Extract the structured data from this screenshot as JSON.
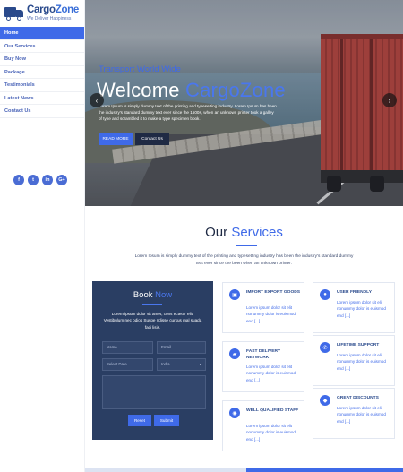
{
  "brand": {
    "name_a": "Cargo",
    "name_b": "Zone",
    "tagline": "We Deliver Happiness"
  },
  "nav": [
    "Home",
    "Our Services",
    "Buy Now",
    "Package",
    "Testimonials",
    "Latest News",
    "Contact Us"
  ],
  "socials": [
    {
      "icon": "facebook-icon",
      "glyph": "f"
    },
    {
      "icon": "twitter-icon",
      "glyph": "t"
    },
    {
      "icon": "linkedin-icon",
      "glyph": "in"
    },
    {
      "icon": "google-plus-icon",
      "glyph": "G+"
    }
  ],
  "hero": {
    "subtitle": "Transport World Wide",
    "title_a": "Welcome",
    "title_b": "CargoZone",
    "description": "Lorem Ipsum is simply dummy text of the printing and typesetting industry. Lorem Ipsum has been the industry's standard dummy text ever since the 1500s, when an unknown printer took a galley of type and scrambled it to make a type specimen book.",
    "read_more": "READ MORE",
    "contact": "Contact Us",
    "prev": "‹",
    "next": "›"
  },
  "services": {
    "heading_a": "Our",
    "heading_b": "Services",
    "intro": "Lorem Ipsum is simply dummy text of the printing and typesetting industry has been the industry's standard dummy text ever since the been when an unknown printer."
  },
  "booking": {
    "title_a": "Book",
    "title_b": "Now",
    "description": "Lorem ipsum dolor sit amet, cons ectetur elit. Vestibulum nec odios Suspe ndisse cursus mal suada faci lisis.",
    "name_placeholder": "Name",
    "email_placeholder": "Email",
    "date_placeholder": "Select Date",
    "select_value": "India",
    "reset": "Reset",
    "submit": "Submit"
  },
  "cards": [
    {
      "icon": "box-icon",
      "glyph": "▣",
      "title": "IMPORT EXPORT GOODS",
      "text": "Lorem ipsum dolor sit elit nonummy dolor is euismod end [...]"
    },
    {
      "icon": "user-icon",
      "glyph": "●",
      "title": "USER FRIENDLY",
      "text": "Lorem ipsum dolor sit elit nonummy dolor is euismod end [...]"
    },
    {
      "icon": "truck-icon",
      "glyph": "▰",
      "title": "FAST DELIVERY NETWORK",
      "text": "Lorem ipsum dolor sit elit nonummy dolor is euismod end [...]"
    },
    {
      "icon": "support-icon",
      "glyph": "✆",
      "title": "LIFETIME SUPPORT",
      "text": "Lorem ipsum dolor sit elit nonummy dolor is euismod end [...]"
    },
    {
      "icon": "location-icon",
      "glyph": "◉",
      "title": "WELL QUALIFIED STAFF",
      "text": "Lorem ipsum dolor sit elit nonummy dolor is euismod end [...]"
    },
    {
      "icon": "tag-icon",
      "glyph": "◆",
      "title": "GREAT DISCOUNTS",
      "text": "Lorem ipsum dolor sit elit nonummy dolor is euismod end [...]"
    }
  ],
  "colors": {
    "accent": "#3f6ae8",
    "navy": "#2a3e63",
    "brand": "#2a4a8c"
  }
}
